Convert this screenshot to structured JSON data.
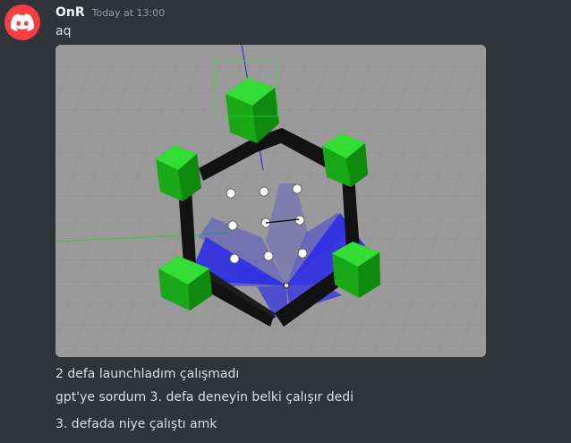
{
  "message": {
    "author": "OnR",
    "timestamp": "Today at 13:00",
    "lines": [
      "aq",
      "2 defa launchladım çalışmadı",
      "gpt'ye sordum 3. defa deneyin belki çalışır dedi",
      "3. defada niye çalıştı amk"
    ],
    "avatar_icon": "discord-logo-icon",
    "attachment_icon": "gazebo-simulation-screenshot"
  },
  "colors": {
    "background": "#313338",
    "avatar": "#f23f43",
    "username": "#f2f3f5",
    "timestamp": "#949ba4",
    "text": "#dbdee1",
    "ground": "#9a9a9a",
    "walls": "#151515",
    "pillars": "#1fbf1f",
    "lidar": "#2e2ee6"
  }
}
